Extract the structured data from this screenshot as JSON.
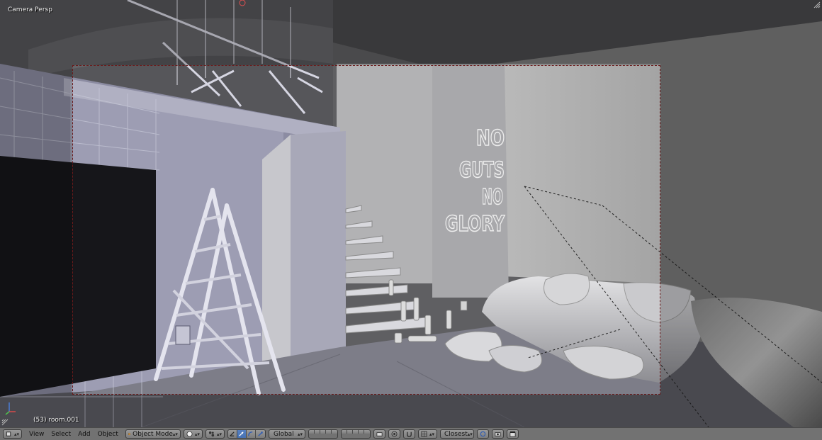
{
  "viewport": {
    "view_label": "Camera Persp",
    "object_info": "(53) room.001",
    "wall_text": [
      "NO",
      "GUTS",
      "NO",
      "GLORY"
    ]
  },
  "header": {
    "editor_icon": "3d-view-cube-icon",
    "menus": [
      "View",
      "Select",
      "Add",
      "Object"
    ],
    "mode": "Object Mode",
    "shading_icon": "solid-sphere-icon",
    "pivot_icon": "pivot-point-icon",
    "transform_orientation": "Global",
    "snap_target": "Closest",
    "colors": {
      "header_bg": "#727272",
      "selected_blue": "#4772b3",
      "camera_frame": "#6b1a1a"
    }
  }
}
